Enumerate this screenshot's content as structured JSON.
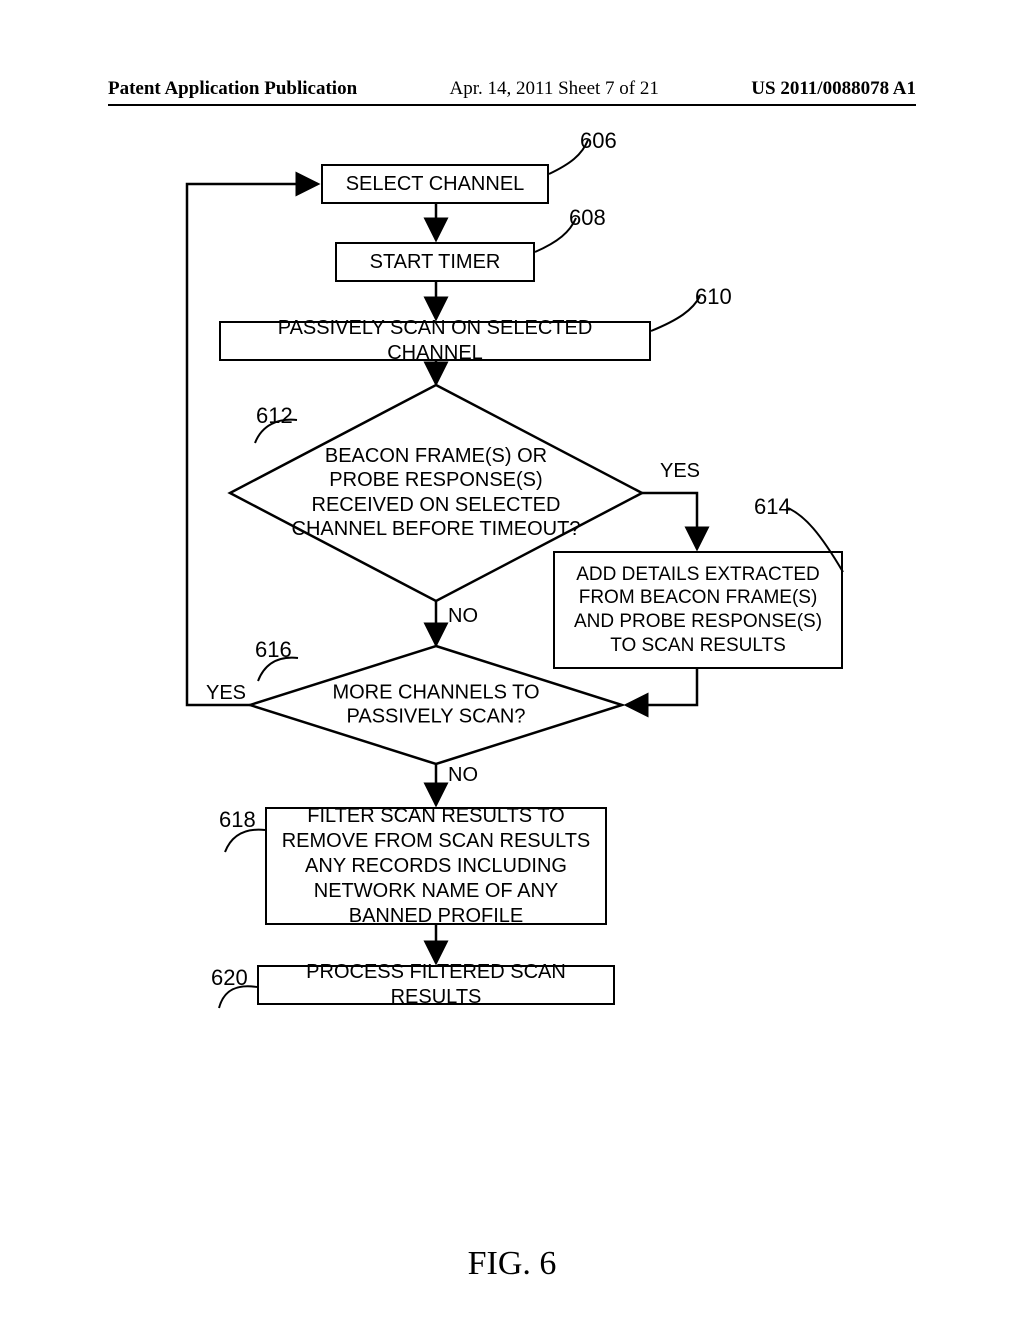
{
  "header": {
    "left": "Patent Application Publication",
    "center": "Apr. 14, 2011  Sheet 7 of 21",
    "right": "US 2011/0088078 A1"
  },
  "refs": {
    "r606": "606",
    "r608": "608",
    "r610": "610",
    "r612": "612",
    "r614": "614",
    "r616": "616",
    "r618": "618",
    "r620": "620"
  },
  "labels": {
    "yes1": "YES",
    "no1": "NO",
    "yes2": "YES",
    "no2": "NO"
  },
  "boxes": {
    "b606": "SELECT CHANNEL",
    "b608": "START TIMER",
    "b610": "PASSIVELY SCAN ON SELECTED CHANNEL",
    "d612": "BEACON FRAME(S) OR PROBE RESPONSE(S) RECEIVED ON SELECTED CHANNEL BEFORE TIMEOUT?",
    "b614": "ADD DETAILS EXTRACTED FROM BEACON FRAME(S) AND PROBE RESPONSE(S) TO SCAN RESULTS",
    "d616": "MORE CHANNELS TO PASSIVELY SCAN?",
    "b618": "FILTER SCAN RESULTS TO REMOVE FROM SCAN RESULTS ANY RECORDS INCLUDING NETWORK NAME OF ANY BANNED PROFILE",
    "b620": "PROCESS FILTERED SCAN RESULTS"
  },
  "figure": "FIG. 6"
}
